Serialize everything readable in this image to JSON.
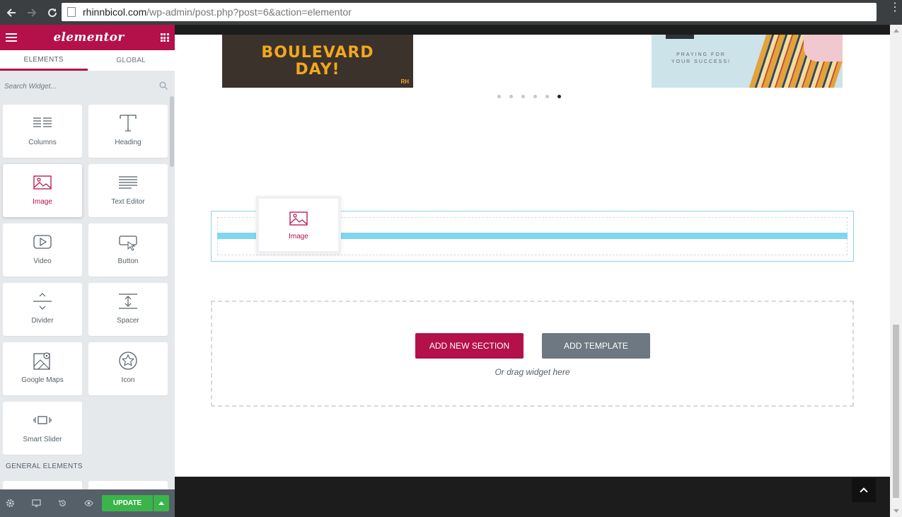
{
  "browser": {
    "url_host": "rhinnbicol.com",
    "url_path": "/wp-admin/post.php?post=6&action=elementor"
  },
  "panel": {
    "logo": "elementor",
    "tabs": [
      {
        "label": "ELEMENTS",
        "active": true
      },
      {
        "label": "GLOBAL",
        "active": false
      }
    ],
    "search_placeholder": "Search Widget...",
    "widgets": [
      {
        "label": "Columns",
        "icon": "columns-icon"
      },
      {
        "label": "Heading",
        "icon": "heading-icon"
      },
      {
        "label": "Image",
        "icon": "image-icon",
        "selected": true
      },
      {
        "label": "Text Editor",
        "icon": "text-editor-icon"
      },
      {
        "label": "Video",
        "icon": "video-icon"
      },
      {
        "label": "Button",
        "icon": "button-icon"
      },
      {
        "label": "Divider",
        "icon": "divider-icon"
      },
      {
        "label": "Spacer",
        "icon": "spacer-icon"
      },
      {
        "label": "Google Maps",
        "icon": "google-maps-icon"
      },
      {
        "label": "Icon",
        "icon": "star-icon"
      },
      {
        "label": "Smart Slider",
        "icon": "smart-slider-icon"
      }
    ],
    "section_title": "GENERAL ELEMENTS",
    "update_label": "UPDATE"
  },
  "preview": {
    "slide1_text": "BOULEVARD DAY!",
    "slide1_line1": "BOULEVARD",
    "slide1_line2": "DAY!",
    "slide1_logo": "RH",
    "slide2_line1": "PRAYING FOR",
    "slide2_line2": "YOUR SUCCESS!",
    "slider_dots": 6,
    "active_dot": 6,
    "drag_widget_label": "Image",
    "add_section_label": "ADD NEW SECTION",
    "add_template_label": "ADD TEMPLATE",
    "drag_hint": "Or drag widget here"
  },
  "colors": {
    "accent": "#b4104a",
    "success": "#39b54a",
    "drop_indicator": "#7fd6ef"
  }
}
